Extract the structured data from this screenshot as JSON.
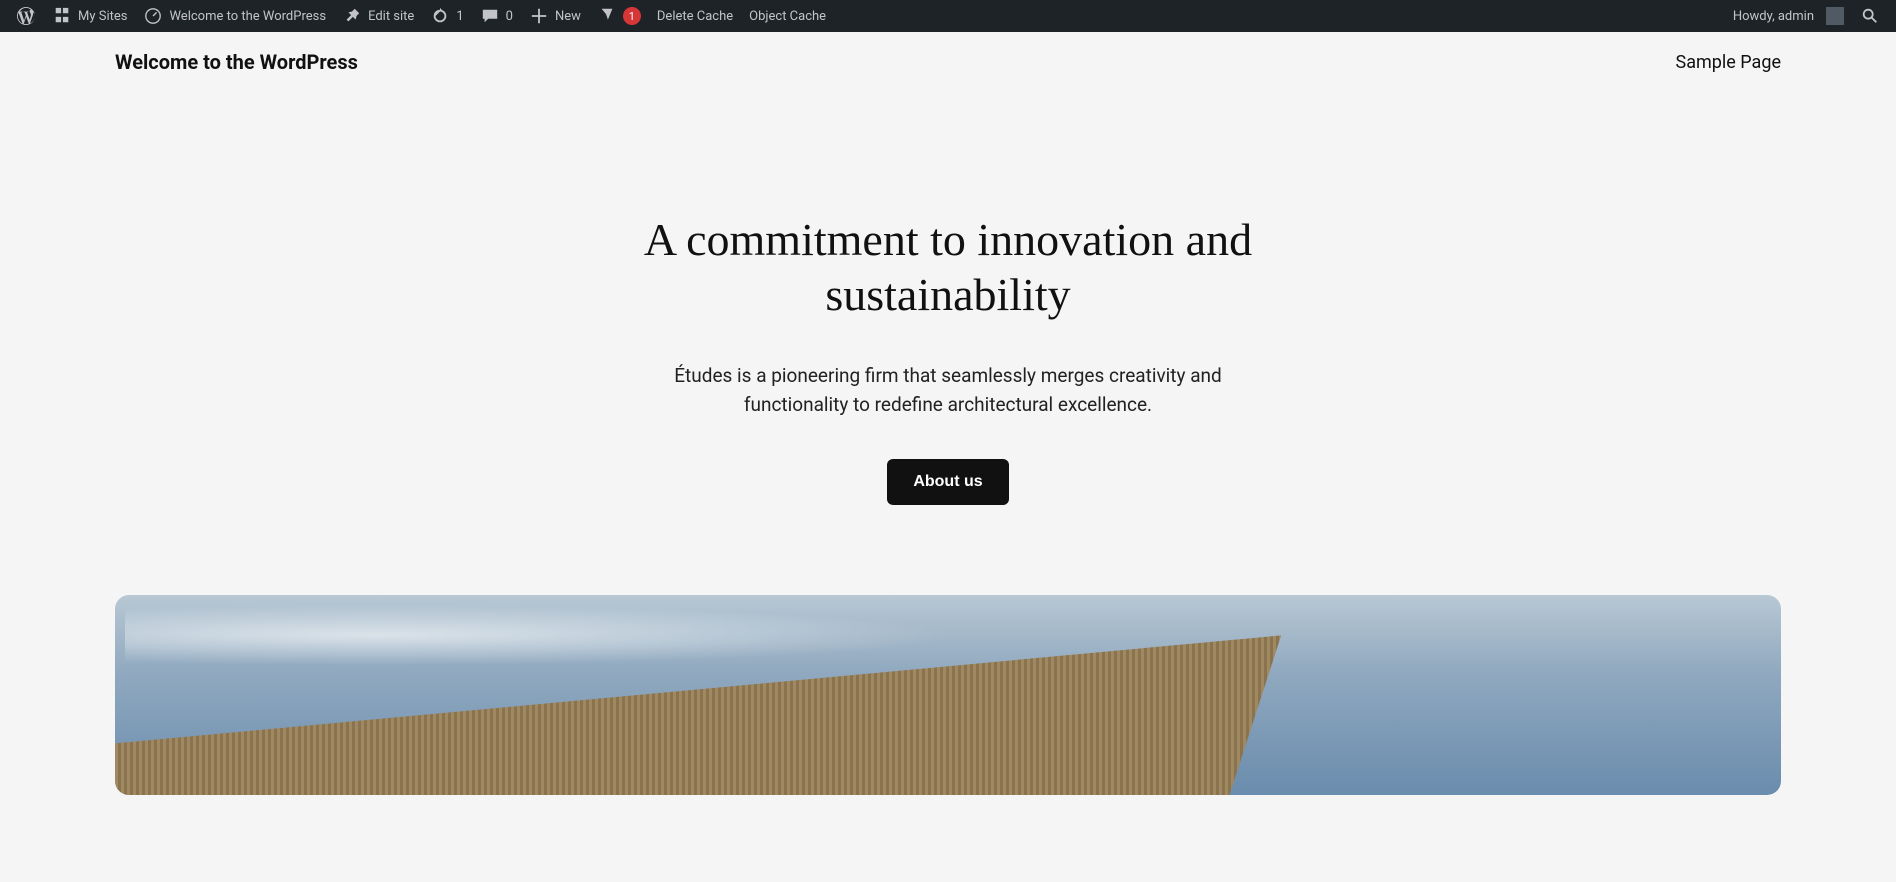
{
  "adminbar": {
    "mySites": "My Sites",
    "siteName": "Welcome to the WordPress",
    "editSite": "Edit site",
    "updates": "1",
    "comments": "0",
    "new": "New",
    "yoastBadge": "1",
    "deleteCache": "Delete Cache",
    "objectCache": "Object Cache",
    "howdy": "Howdy, admin"
  },
  "header": {
    "siteTitle": "Welcome to the WordPress",
    "navItem": "Sample Page"
  },
  "hero": {
    "headline": "A commitment to innovation and sustainability",
    "subtext": "Études is a pioneering firm that seamlessly merges creativity and functionality to redefine architectural excellence.",
    "cta": "About us"
  }
}
